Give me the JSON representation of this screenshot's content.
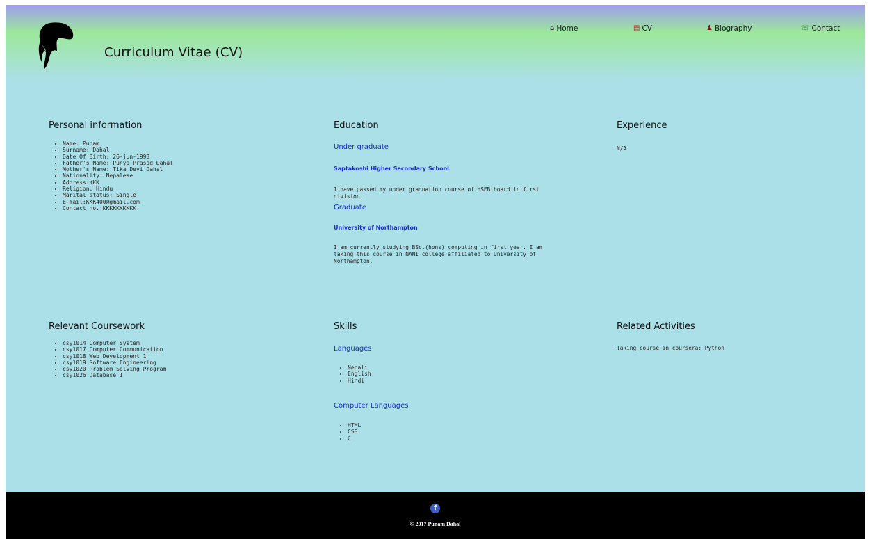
{
  "header": {
    "title": "Curriculum Vitae (CV)",
    "nav": [
      {
        "label": "Home",
        "icon": "home-icon"
      },
      {
        "label": "CV",
        "icon": "document-icon"
      },
      {
        "label": "Biography",
        "icon": "person-icon"
      },
      {
        "label": "Contact",
        "icon": "phone-icon"
      }
    ]
  },
  "personal": {
    "heading": "Personal information",
    "items": [
      "Name: Punam",
      "Surname: Dahal",
      "Date Of Birth: 26-jun-1998",
      "Father's Name: Punya Prasad Dahal",
      "Mother's Name: Tika Devi Dahal",
      "Nationality: Nepalese",
      "Address:KKK",
      "Religion: Hindu",
      "Marital status: Single",
      "E-mail:KKK400@gmail.com",
      "Contact no.:KKKKKKKKKK"
    ]
  },
  "education": {
    "heading": "Education",
    "undergrad_heading": "Under graduate",
    "undergrad_school": "Saptakoshi Higher Secondary School",
    "undergrad_text": "I have passed my under graduation course of HSEB board in first division.",
    "grad_heading": "Graduate",
    "grad_school": "University of Northampton",
    "grad_text": "I am currently studying BSc.(hons) computing in first year. I am taking this course in NAMI college affiliated to University of Northampton."
  },
  "experience": {
    "heading": "Experience",
    "text": "N/A"
  },
  "coursework": {
    "heading": "Relevant Coursework",
    "items": [
      "csy1014 Computer System",
      "csy1017 Computer Communication",
      "csy1018 Web Development 1",
      "csy1019 Software Engineering",
      "csy1020 Problem Solving Program",
      "csy1026 Database 1"
    ]
  },
  "skills": {
    "heading": "Skills",
    "languages_heading": "Languages",
    "languages": [
      "Nepali",
      "English",
      "Hindi"
    ],
    "computer_heading": "Computer Languages",
    "computer_languages": [
      "HTML",
      "CSS",
      "C"
    ]
  },
  "activities": {
    "heading": "Related Activities",
    "text": "Taking course in coursera: Python"
  },
  "footer": {
    "social_icon_letter": "f",
    "copyright": "© 2017 Punam Dahal"
  },
  "colors": {
    "background": "#ace0e8",
    "header_top": "#9f9eee",
    "header_green": "#9ce89a",
    "link_blue": "#1a2fd0",
    "footer": "#000000"
  }
}
